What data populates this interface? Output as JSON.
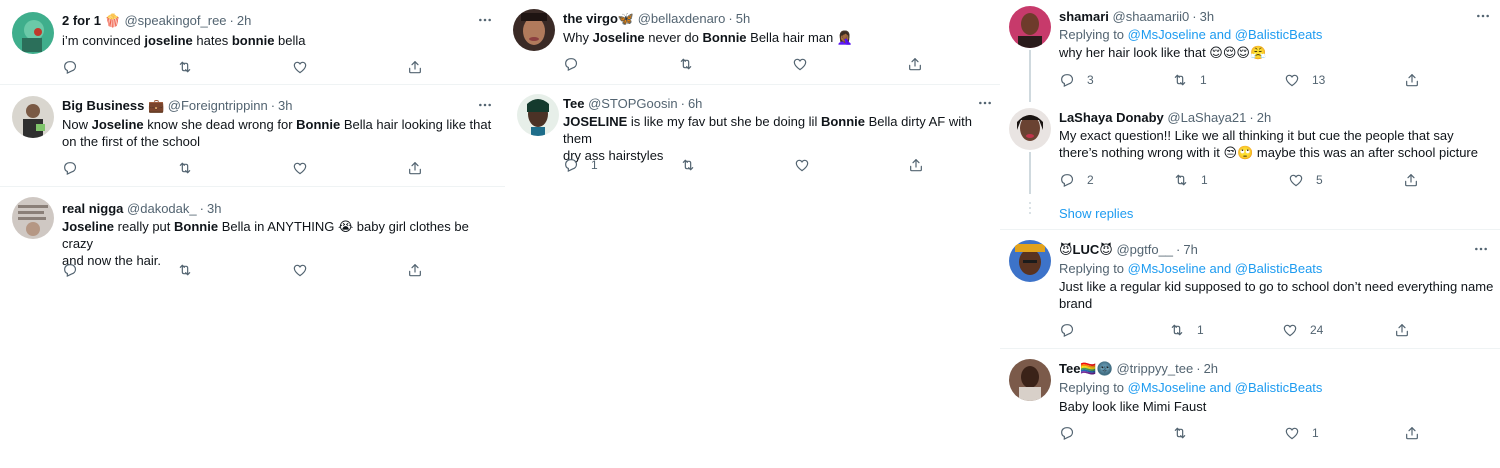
{
  "colors": {
    "text": "#0f1419",
    "muted": "#536471",
    "link": "#1d9bf0",
    "border": "#eff3f4"
  },
  "left": {
    "tweets": [
      {
        "name": "2 for 1 🍿",
        "handle": "@speakingof_ree",
        "time": "2h",
        "text": [
          "i’m convinced ",
          "joseline",
          " hates ",
          "bonnie",
          " bella"
        ],
        "reply_count": "",
        "retweet_count": "",
        "like_count": ""
      },
      {
        "name": "Big Business 💼",
        "handle": "@Foreigntrippinn",
        "time": "3h",
        "line1": [
          "Now ",
          "Joseline",
          " know she dead wrong for ",
          "Bonnie",
          " Bella hair looking like that"
        ],
        "line2": "on the first of the school"
      },
      {
        "name": "real nigga",
        "handle": "@dakodak_",
        "time": "3h",
        "line1": [
          "Joseline",
          " really put ",
          "Bonnie",
          " Bella in ANYTHING 😭 baby girl clothes be crazy"
        ],
        "line2": "and now the hair."
      }
    ]
  },
  "middle": {
    "tweets": [
      {
        "name": "the virgo🦋",
        "handle": "@bellaxdenaro",
        "time": "5h",
        "text": [
          "Why ",
          "Joseline",
          " never do ",
          "Bonnie",
          " Bella hair man 🤦🏾‍♀️"
        ]
      },
      {
        "name": "Tee",
        "handle": "@STOPGoosin",
        "time": "6h",
        "line1": [
          "JOSELINE",
          " is like my fav but she be doing lil ",
          "Bonnie",
          " Bella dirty AF with them"
        ],
        "line2": "dry ass hairstyles",
        "reply_count": "1"
      }
    ]
  },
  "right": {
    "replying_prefix": "Replying to ",
    "mentions": "@MsJoseline and @BalisticBeats",
    "show_replies": "Show replies",
    "tweets": [
      {
        "name": "shamari",
        "handle": "@shaamarii0",
        "time": "3h",
        "text": "why her hair look like that 😌😌😌😤",
        "reply_count": "3",
        "retweet_count": "1",
        "like_count": "13"
      },
      {
        "name": "LaShaya Donaby",
        "handle": "@LaShaya21",
        "time": "2h",
        "line1": "My exact question!! Like we all thinking it but cue the people that say",
        "line2": "there’s nothing wrong with it 😒🙄 maybe this was an after school picture",
        "reply_count": "2",
        "retweet_count": "1",
        "like_count": "5"
      },
      {
        "name": "😈LUC😈",
        "handle": "@pgtfo__",
        "time": "7h",
        "line1": "Just like a regular kid supposed to go to school don’t need everything name",
        "line2": "brand",
        "reply_count": "",
        "retweet_count": "1",
        "like_count": "24"
      },
      {
        "name": "Tee🏳️‍🌈🌚",
        "handle": "@trippyy_tee",
        "time": "2h",
        "text": "Baby look like Mimi Faust",
        "reply_count": "",
        "retweet_count": "",
        "like_count": "1"
      }
    ]
  }
}
